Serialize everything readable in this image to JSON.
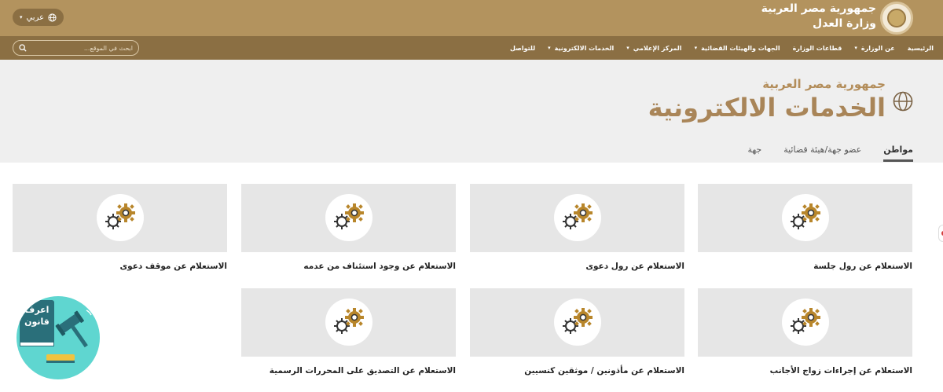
{
  "header": {
    "lang_label": "عربي",
    "brand_line1": "جمهورية مصر العربية",
    "brand_line2": "وزارة العدل"
  },
  "nav": {
    "search_placeholder": "ابحث في الموقع...",
    "items": [
      {
        "label": "الرئيسية",
        "dropdown": false
      },
      {
        "label": "عن الوزارة",
        "dropdown": true
      },
      {
        "label": "قطاعات الوزارة",
        "dropdown": false
      },
      {
        "label": "الجهات والهيئات القضائية",
        "dropdown": true
      },
      {
        "label": "المركز الإعلامي",
        "dropdown": true
      },
      {
        "label": "الخدمات الالكترونية",
        "dropdown": true
      },
      {
        "label": "للتواصل",
        "dropdown": false
      }
    ]
  },
  "hero": {
    "subtitle": "جمهورية مصر العربية",
    "title": "الخدمات الالكترونية"
  },
  "tabs": [
    {
      "label": "مواطن",
      "active": true
    },
    {
      "label": "عضو جهة/هيئة قضائية",
      "active": false
    },
    {
      "label": "جهة",
      "active": false
    }
  ],
  "cards": [
    {
      "label": "الاستعلام عن رول جلسة"
    },
    {
      "label": "الاستعلام عن رول دعوى"
    },
    {
      "label": "الاستعلام عن وجود استئناف من عدمه"
    },
    {
      "label": "الاستعلام عن موقف دعوى"
    },
    {
      "label": "الاستعلام عن إجراءات زواج الأجانب"
    },
    {
      "label": "الاستعلام عن مأذونين / موثقين كنسيين"
    },
    {
      "label": "الاستعلام عن التصديق على المحررات الرسمية"
    }
  ],
  "badge": {
    "line1": "اعرف",
    "line2": "قانون"
  },
  "colors": {
    "topbar": "#b3935e",
    "navbar": "#8b6f43",
    "hero_bg": "#efefef",
    "title_gold": "#a98558",
    "gear_gold": "#b8862b",
    "badge_teal": "#5fd6d0"
  }
}
